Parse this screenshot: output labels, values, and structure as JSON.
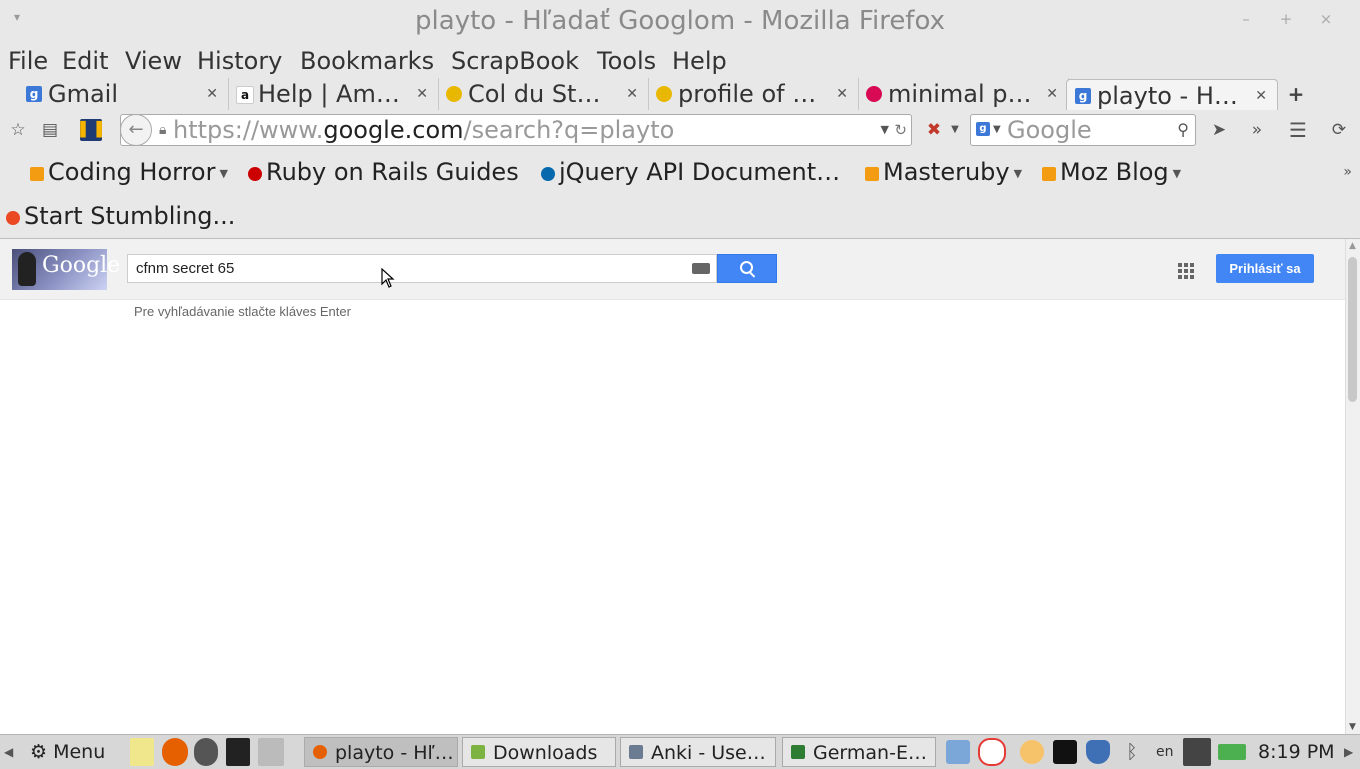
{
  "window": {
    "title": "playto - Hľadať Googlom - Mozilla Firefox",
    "controls": {
      "minimize": "–",
      "maximize": "+",
      "close": "×"
    }
  },
  "menubar": [
    "File",
    "Edit",
    "View",
    "History",
    "Bookmarks",
    "ScrapBook",
    "Tools",
    "Help"
  ],
  "tabs": [
    {
      "label": "Gmail",
      "favicon": "google-icon"
    },
    {
      "label": "Help | Am…",
      "favicon": "amazon-icon"
    },
    {
      "label": "Col du St…",
      "favicon": "strava-icon"
    },
    {
      "label": "profile of …",
      "favicon": "strava-icon"
    },
    {
      "label": "minimal p…",
      "favicon": "debian-icon"
    },
    {
      "label": "playto - H…",
      "favicon": "google-icon",
      "active": true
    }
  ],
  "newtab_label": "+",
  "urlbar": {
    "prefix": "https://www.",
    "domain": "google.com",
    "path": "/search?q=playto"
  },
  "searchbar": {
    "placeholder": "Google"
  },
  "bookmarks": [
    {
      "label": "Coding Horror",
      "icon": "rss-icon",
      "dropdown": true
    },
    {
      "label": "Ruby on Rails Guides",
      "icon": "rails-icon",
      "dropdown": false
    },
    {
      "label": "jQuery API Document…",
      "icon": "jquery-icon",
      "dropdown": false
    },
    {
      "label": "Masteruby",
      "icon": "rss-icon",
      "dropdown": true
    },
    {
      "label": "Moz Blog",
      "icon": "rss-icon",
      "dropdown": true
    },
    {
      "label": "Start Stumbling...",
      "icon": "stumbleupon-icon",
      "dropdown": false
    }
  ],
  "google": {
    "logo_text": "Google",
    "query": "cfnm secret 65",
    "signin_label": "Prihlásiť sa",
    "hint": "Pre vyhľadávanie stlačte kláves Enter"
  },
  "taskbar": {
    "menu_label": "Menu",
    "tasks": [
      {
        "label": "playto - Hľ…",
        "icon": "firefox-icon",
        "active": true
      },
      {
        "label": "Downloads",
        "icon": "folder-icon",
        "active": false
      },
      {
        "label": "Anki - Use…",
        "icon": "anki-icon",
        "active": false
      },
      {
        "label": "German-E…",
        "icon": "spreadsheet-icon",
        "active": false
      }
    ],
    "lang": "en",
    "clock": "8:19 PM"
  },
  "colors": {
    "accent": "#4285f4",
    "chrome_bg": "#e8e8e8",
    "taskbar_bg": "#d7d7d7"
  }
}
